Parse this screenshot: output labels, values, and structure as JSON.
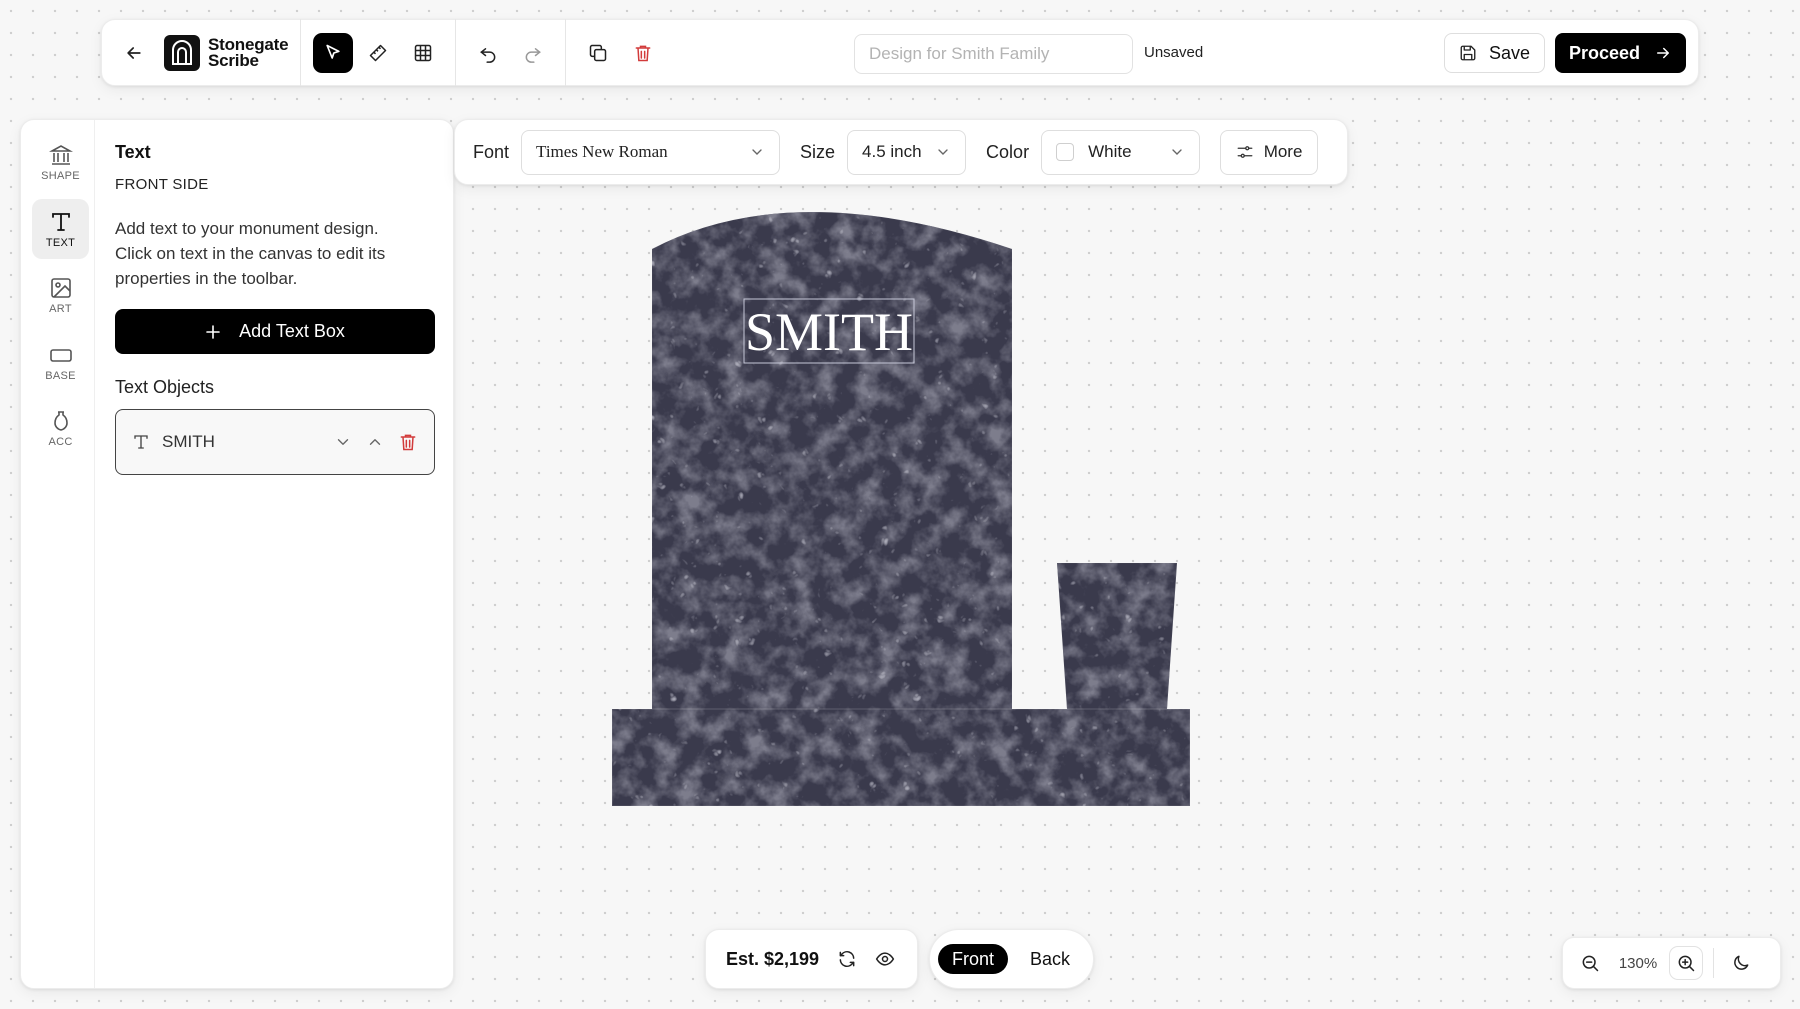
{
  "app": {
    "brand_line1": "Stonegate",
    "brand_line2": "Scribe"
  },
  "topbar": {
    "design_name_value": "",
    "design_name_placeholder": "Design for Smith Family",
    "status": "Unsaved",
    "save_label": "Save",
    "proceed_label": "Proceed"
  },
  "rail": [
    {
      "label": "SHAPE",
      "icon": "monument-icon"
    },
    {
      "label": "TEXT",
      "icon": "text-icon"
    },
    {
      "label": "ART",
      "icon": "image-icon"
    },
    {
      "label": "BASE",
      "icon": "base-icon"
    },
    {
      "label": "ACC",
      "icon": "vase-icon"
    }
  ],
  "panel": {
    "title": "Text",
    "subtitle": "FRONT SIDE",
    "description": "Add text to your monument design. Click on text in the canvas to edit its properties in the toolbar.",
    "add_button": "Add Text Box",
    "objects_heading": "Text Objects",
    "objects": [
      {
        "label": "SMITH"
      }
    ]
  },
  "properties": {
    "font_label": "Font",
    "font_value": "Times New Roman",
    "size_label": "Size",
    "size_value": "4.5 inch",
    "color_label": "Color",
    "color_value": "White",
    "more_label": "More"
  },
  "canvas": {
    "inscription": "SMITH",
    "stone_color": "#3a3a4c"
  },
  "footer": {
    "estimate": "Est. $2,199",
    "front_label": "Front",
    "back_label": "Back",
    "zoom": "130%"
  }
}
